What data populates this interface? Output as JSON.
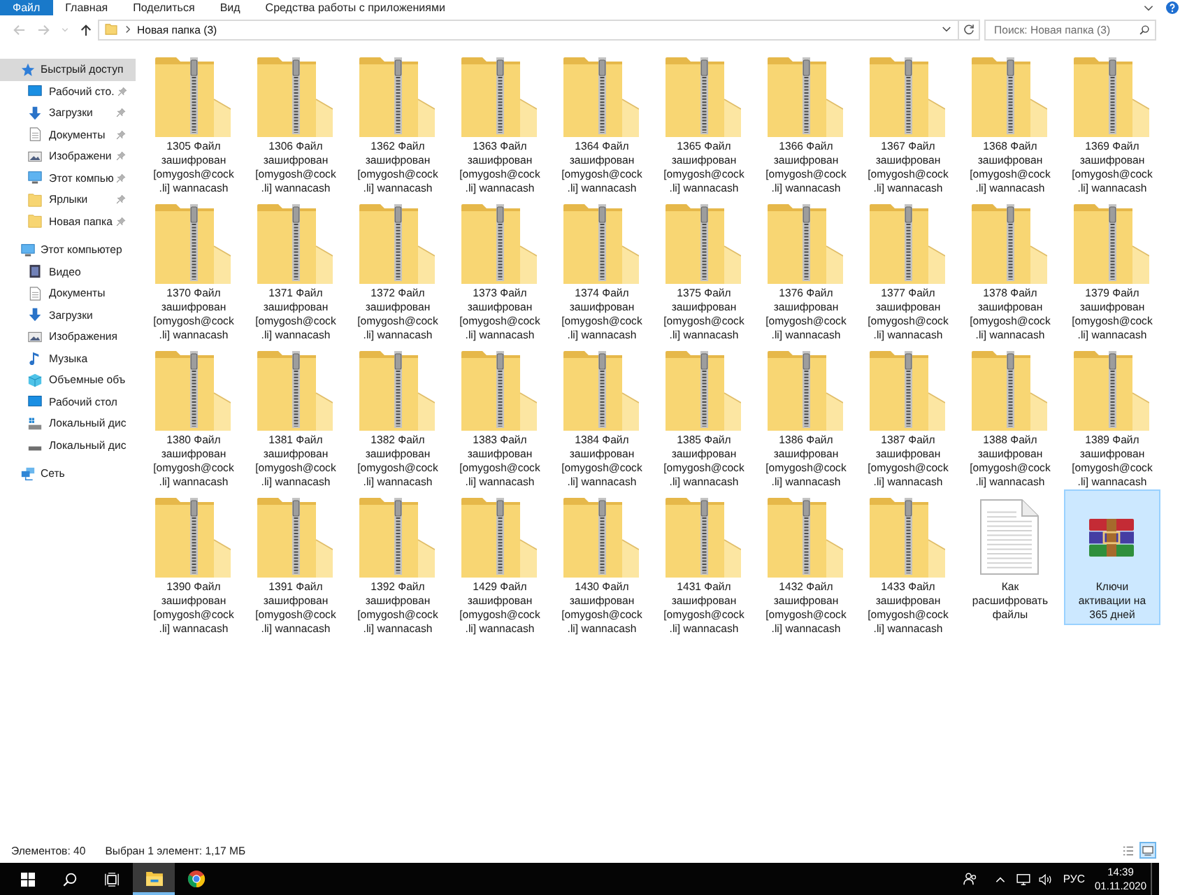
{
  "ribbon": {
    "tabs": [
      {
        "label": "Файл",
        "kind": "file"
      },
      {
        "label": "Главная",
        "kind": "tab"
      },
      {
        "label": "Поделиться",
        "kind": "tab"
      },
      {
        "label": "Вид",
        "kind": "tab"
      },
      {
        "label": "Средства работы с приложениями",
        "kind": "tab"
      }
    ]
  },
  "address_bar": {
    "nav_buttons": [
      {
        "kind": "back",
        "disabled": true
      },
      {
        "kind": "forward",
        "disabled": true
      },
      {
        "kind": "up",
        "disabled": false
      }
    ],
    "path": [
      "Новая папка (3)"
    ]
  },
  "search": {
    "placeholder": "Поиск: Новая папка (3)"
  },
  "sidebar": {
    "items": [
      {
        "label": "Быстрый доступ",
        "kind": "star",
        "selected": true,
        "children": [
          {
            "label": "Рабочий сто.",
            "kind": "desktop",
            "selected": false,
            "pinned": true
          },
          {
            "label": "Загрузки",
            "kind": "download",
            "selected": false,
            "pinned": true
          },
          {
            "label": "Документы",
            "kind": "document",
            "selected": false,
            "pinned": true
          },
          {
            "label": "Изображени",
            "kind": "pictures",
            "selected": false,
            "pinned": true
          },
          {
            "label": "Этот компью",
            "kind": "computer",
            "selected": false,
            "pinned": true
          },
          {
            "label": "Ярлыки",
            "kind": "folder",
            "selected": false,
            "pinned": true
          },
          {
            "label": "Новая папка",
            "kind": "folder",
            "selected": false,
            "pinned": true
          }
        ]
      },
      {
        "label": "Этот компьютер",
        "kind": "computer",
        "selected": false,
        "children": [
          {
            "label": "Видео",
            "kind": "video",
            "selected": false
          },
          {
            "label": "Документы",
            "kind": "document",
            "selected": false
          },
          {
            "label": "Загрузки",
            "kind": "download",
            "selected": false
          },
          {
            "label": "Изображения",
            "kind": "pictures",
            "selected": false
          },
          {
            "label": "Музыка",
            "kind": "music",
            "selected": false
          },
          {
            "label": "Объемные объ",
            "kind": "objects-3d",
            "selected": false
          },
          {
            "label": "Рабочий стол",
            "kind": "desktop",
            "selected": false
          },
          {
            "label": "Локальный дис",
            "kind": "drive-system",
            "selected": false
          },
          {
            "label": "Локальный дис",
            "kind": "drive",
            "selected": false
          }
        ]
      },
      {
        "label": "Сеть",
        "kind": "network",
        "selected": false
      }
    ]
  },
  "files": [
    {
      "name": "1305 Файл зашифрован [omygosh@cock.li] wannacash",
      "kind": "zip-folder",
      "selected": false
    },
    {
      "name": "1306 Файл зашифрован [omygosh@cock.li] wannacash",
      "kind": "zip-folder",
      "selected": false
    },
    {
      "name": "1362 Файл зашифрован [omygosh@cock.li] wannacash",
      "kind": "zip-folder",
      "selected": false
    },
    {
      "name": "1363 Файл зашифрован [omygosh@cock.li] wannacash",
      "kind": "zip-folder",
      "selected": false
    },
    {
      "name": "1364 Файл зашифрован [omygosh@cock.li] wannacash",
      "kind": "zip-folder",
      "selected": false
    },
    {
      "name": "1365 Файл зашифрован [omygosh@cock.li] wannacash",
      "kind": "zip-folder",
      "selected": false
    },
    {
      "name": "1366 Файл зашифрован [omygosh@cock.li] wannacash",
      "kind": "zip-folder",
      "selected": false
    },
    {
      "name": "1367 Файл зашифрован [omygosh@cock.li] wannacash",
      "kind": "zip-folder",
      "selected": false
    },
    {
      "name": "1368 Файл зашифрован [omygosh@cock.li] wannacash",
      "kind": "zip-folder",
      "selected": false
    },
    {
      "name": "1369 Файл зашифрован [omygosh@cock.li] wannacash",
      "kind": "zip-folder",
      "selected": false
    },
    {
      "name": "1370 Файл зашифрован [omygosh@cock.li] wannacash",
      "kind": "zip-folder",
      "selected": false
    },
    {
      "name": "1371 Файл зашифрован [omygosh@cock.li] wannacash",
      "kind": "zip-folder",
      "selected": false
    },
    {
      "name": "1372 Файл зашифрован [omygosh@cock.li] wannacash",
      "kind": "zip-folder",
      "selected": false
    },
    {
      "name": "1373 Файл зашифрован [omygosh@cock.li] wannacash",
      "kind": "zip-folder",
      "selected": false
    },
    {
      "name": "1374 Файл зашифрован [omygosh@cock.li] wannacash",
      "kind": "zip-folder",
      "selected": false
    },
    {
      "name": "1375 Файл зашифрован [omygosh@cock.li] wannacash",
      "kind": "zip-folder",
      "selected": false
    },
    {
      "name": "1376 Файл зашифрован [omygosh@cock.li] wannacash",
      "kind": "zip-folder",
      "selected": false
    },
    {
      "name": "1377 Файл зашифрован [omygosh@cock.li] wannacash",
      "kind": "zip-folder",
      "selected": false
    },
    {
      "name": "1378 Файл зашифрован [omygosh@cock.li] wannacash",
      "kind": "zip-folder",
      "selected": false
    },
    {
      "name": "1379 Файл зашифрован [omygosh@cock.li] wannacash",
      "kind": "zip-folder",
      "selected": false
    },
    {
      "name": "1380 Файл зашифрован [omygosh@cock.li] wannacash",
      "kind": "zip-folder",
      "selected": false
    },
    {
      "name": "1381 Файл зашифрован [omygosh@cock.li] wannacash",
      "kind": "zip-folder",
      "selected": false
    },
    {
      "name": "1382 Файл зашифрован [omygosh@cock.li] wannacash",
      "kind": "zip-folder",
      "selected": false
    },
    {
      "name": "1383 Файл зашифрован [omygosh@cock.li] wannacash",
      "kind": "zip-folder",
      "selected": false
    },
    {
      "name": "1384 Файл зашифрован [omygosh@cock.li] wannacash",
      "kind": "zip-folder",
      "selected": false
    },
    {
      "name": "1385 Файл зашифрован [omygosh@cock.li] wannacash",
      "kind": "zip-folder",
      "selected": false
    },
    {
      "name": "1386 Файл зашифрован [omygosh@cock.li] wannacash",
      "kind": "zip-folder",
      "selected": false
    },
    {
      "name": "1387 Файл зашифрован [omygosh@cock.li] wannacash",
      "kind": "zip-folder",
      "selected": false
    },
    {
      "name": "1388 Файл зашифрован [omygosh@cock.li] wannacash",
      "kind": "zip-folder",
      "selected": false
    },
    {
      "name": "1389 Файл зашифрован [omygosh@cock.li] wannacash",
      "kind": "zip-folder",
      "selected": false
    },
    {
      "name": "1390 Файл зашифрован [omygosh@cock.li] wannacash",
      "kind": "zip-folder",
      "selected": false
    },
    {
      "name": "1391 Файл зашифрован [omygosh@cock.li] wannacash",
      "kind": "zip-folder",
      "selected": false
    },
    {
      "name": "1392 Файл зашифрован [omygosh@cock.li] wannacash",
      "kind": "zip-folder",
      "selected": false
    },
    {
      "name": "1429 Файл зашифрован [omygosh@cock.li] wannacash",
      "kind": "zip-folder",
      "selected": false
    },
    {
      "name": "1430 Файл зашифрован [omygosh@cock.li] wannacash",
      "kind": "zip-folder",
      "selected": false
    },
    {
      "name": "1431 Файл зашифрован [omygosh@cock.li] wannacash",
      "kind": "zip-folder",
      "selected": false
    },
    {
      "name": "1432 Файл зашифрован [omygosh@cock.li] wannacash",
      "kind": "zip-folder",
      "selected": false
    },
    {
      "name": "1433 Файл зашифрован [omygosh@cock.li] wannacash",
      "kind": "zip-folder",
      "selected": false
    },
    {
      "name": "Как расшифровать файлы",
      "kind": "text-file",
      "selected": false
    },
    {
      "name": "Ключи активации на 365 дней",
      "kind": "archive",
      "selected": true
    }
  ],
  "status_bar": {
    "item_count": "Элементов: 40",
    "selection": "Выбран 1 элемент: 1,17 МБ",
    "view_buttons": [
      {
        "kind": "details",
        "selected": false
      },
      {
        "kind": "large-icons",
        "selected": true
      }
    ]
  },
  "taskbar": {
    "apps": [
      {
        "kind": "file-explorer",
        "active": true
      },
      {
        "kind": "browser",
        "active": false
      }
    ],
    "language": "РУС",
    "time": "14:39",
    "date": "01.11.2020"
  }
}
